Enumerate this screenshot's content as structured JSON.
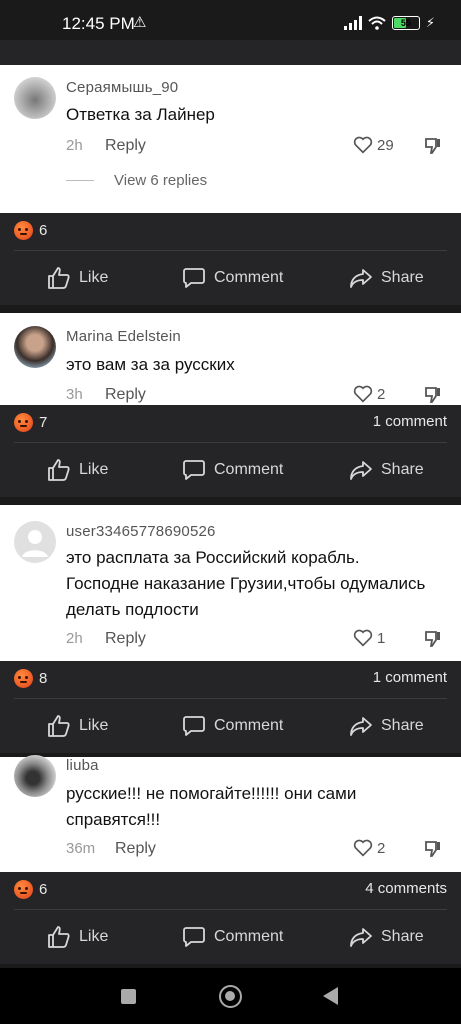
{
  "status": {
    "time": "12:45 PM",
    "warn_icon": "⚠",
    "battery": "55",
    "battery_level": 0.55
  },
  "comments": [
    {
      "author": "Сераямышь_90",
      "text": "Ответка за Лайнер",
      "age": "2h",
      "reply": "Reply",
      "likes": "29",
      "view_replies": "View 6 replies"
    },
    {
      "author": "Marina Edelstein",
      "text": "это вам за за русских",
      "age": "3h",
      "reply": "Reply",
      "likes": "2"
    },
    {
      "author": "user33465778690526",
      "text": "это расплата за Российский корабль. Господне наказание Грузии,чтобы одумались делать подлости",
      "age": "2h",
      "reply": "Reply",
      "likes": "1"
    },
    {
      "author": "liuba",
      "text": "русские!!! не помогайте!!!!!! они сами справятся!!!",
      "age": "36m",
      "reply": "Reply",
      "likes": "2"
    }
  ],
  "posts": [
    {
      "reactions": "6",
      "comments": ""
    },
    {
      "reactions": "7",
      "comments": "1 comment"
    },
    {
      "reactions": "8",
      "comments": "1 comment"
    },
    {
      "reactions": "6",
      "comments": "4 comments"
    }
  ],
  "actions": {
    "like": "Like",
    "comment": "Comment",
    "share": "Share"
  },
  "colors": {
    "panel": "#252527",
    "card": "#ffffff",
    "reaction": "#e4411a"
  }
}
